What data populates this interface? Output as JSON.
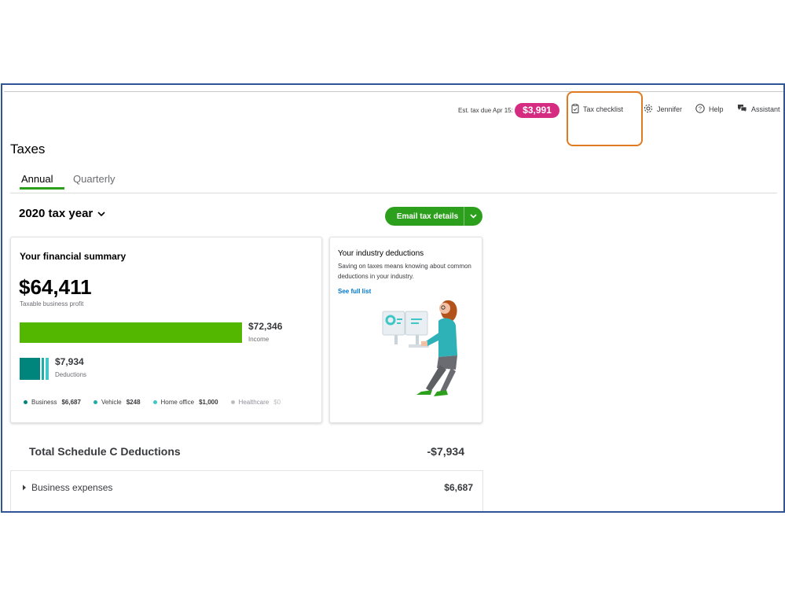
{
  "topbar": {
    "est_label": "Est. tax due Apr 15:",
    "est_amount": "$3,991",
    "tax_checklist": "Tax checklist",
    "user": "Jennifer",
    "help": "Help",
    "assistant": "Assistant"
  },
  "page": {
    "title": "Taxes"
  },
  "tabs": [
    {
      "label": "Annual"
    },
    {
      "label": "Quarterly"
    }
  ],
  "tax_year": "2020 tax year",
  "email_button": "Email tax details",
  "financial_summary": {
    "title": "Your financial summary",
    "profit": "$64,411",
    "profit_label": "Taxable business profit",
    "income": "$72,346",
    "income_label": "Income",
    "deductions": "$7,934",
    "deductions_label": "Deductions",
    "legend": [
      {
        "label": "Business",
        "amount": "$6,687",
        "color": "#00857c"
      },
      {
        "label": "Vehicle",
        "amount": "$248",
        "color": "#21aba5"
      },
      {
        "label": "Home office",
        "amount": "$1,000",
        "color": "#3fc6c6"
      },
      {
        "label": "Healthcare",
        "amount": "$0",
        "color": "#bdbdbd"
      }
    ]
  },
  "industry": {
    "title": "Your industry deductions",
    "text": "Saving on taxes means knowing about common deductions in your industry.",
    "link": "See full list"
  },
  "schedule_c": {
    "label": "Total Schedule C Deductions",
    "amount": "-$7,934"
  },
  "expenses": [
    {
      "label": "Business expenses",
      "amount": "$6,687"
    }
  ],
  "colors": {
    "accent_green": "#2ca01c",
    "badge_pink": "#d52b81",
    "highlight_orange": "#e07a20",
    "frame_blue": "#2f5597"
  }
}
